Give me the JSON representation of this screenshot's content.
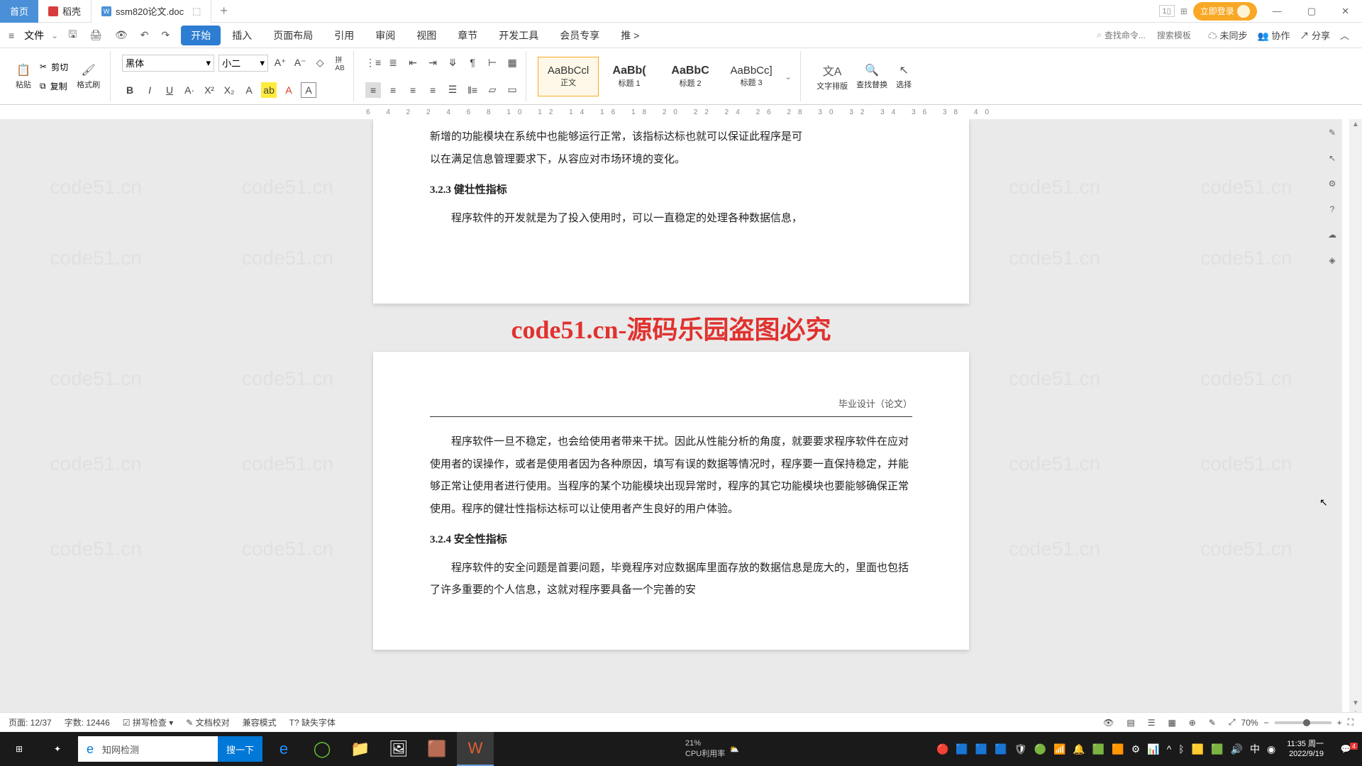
{
  "tabs": {
    "home": "首页",
    "rice": "稻壳",
    "doc": "ssm820论文.doc"
  },
  "login_label": "立即登录",
  "file_menu": "文件",
  "menus": {
    "start": "开始",
    "insert": "插入",
    "layout": "页面布局",
    "ref": "引用",
    "review": "审阅",
    "view": "视图",
    "chapter": "章节",
    "dev": "开发工具",
    "vip": "会员专享",
    "more": "推  >"
  },
  "search": {
    "cmd_placeholder": "查找命令...",
    "tpl_placeholder": "搜索模板"
  },
  "topbar_right": {
    "unsync": "未同步",
    "collab": "协作",
    "share": "分享"
  },
  "ribbon": {
    "paste": "粘贴",
    "cut": "剪切",
    "copy": "复制",
    "format_painter": "格式刷",
    "font_name": "黑体",
    "font_size": "小二",
    "styles": {
      "body": "正文",
      "h1": "标题 1",
      "h2": "标题 2",
      "h3": "标题 3",
      "preview": "AaBbCcl",
      "preview_bold": "AaBb(",
      "preview2": "AaBbC",
      "preview3": "AaBbCc]"
    },
    "text_arrange": "文字排版",
    "find_replace": "查找替换",
    "select": "选择"
  },
  "ruler_marks": "6  4  2  2  4  6  8  10 12 14 16 18 20 22 24 26 28 30 32 34 36 38 40",
  "watermark_text": "code51.cn",
  "big_watermark": "code51.cn-源码乐园盗图必究",
  "doc": {
    "p1_line1": "新增的功能模块在系统中也能够运行正常，该指标达标也就可以保证此程序是可",
    "p1_line2": "以在满足信息管理要求下，从容应对市场环境的变化。",
    "h323": "3.2.3  健壮性指标",
    "p2": "程序软件的开发就是为了投入使用时，可以一直稳定的处理各种数据信息，",
    "page_header": "毕业设计（论文）",
    "p3": "程序软件一旦不稳定，也会给使用者带来干扰。因此从性能分析的角度，就要要求程序软件在应对使用者的误操作，或者是使用者因为各种原因，填写有误的数据等情况时，程序要一直保持稳定，并能够正常让使用者进行使用。当程序的某个功能模块出现异常时，程序的其它功能模块也要能够确保正常使用。程序的健壮性指标达标可以让使用者产生良好的用户体验。",
    "h324": "3.2.4  安全性指标",
    "p4": "程序软件的安全问题是首要问题，毕竟程序对应数据库里面存放的数据信息是庞大的，里面也包括了许多重要的个人信息，这就对程序要具备一个完善的安"
  },
  "status": {
    "page": "页面: 12/37",
    "words": "字数: 12446",
    "spellcheck": "拼写检查",
    "proofread": "文档校对",
    "compat": "兼容模式",
    "missing_font": "缺失字体",
    "zoom": "70%"
  },
  "taskbar": {
    "search_text": "知网检测",
    "search_btn": "搜一下",
    "center_pct": "21%",
    "center_lbl": "CPU利用率",
    "time": "11:35 周一",
    "date": "2022/9/19",
    "notif_count": "4"
  }
}
